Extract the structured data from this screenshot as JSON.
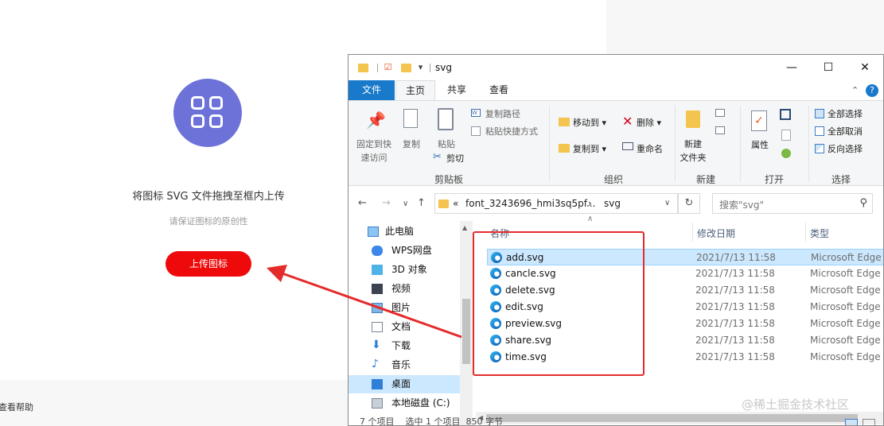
{
  "upload": {
    "title": "将图标 SVG 文件拖拽至框内上传",
    "subtitle": "请保证图标的原创性",
    "button": "上传图标",
    "help": "查看帮助",
    "accent_color": "#ee0a0a",
    "logo_color": "#6d72d8"
  },
  "window": {
    "title": "svg",
    "controls": {
      "minimize": "—",
      "maximize": "☐",
      "close": "✕"
    }
  },
  "ribbon": {
    "tabs": [
      "文件",
      "主页",
      "共享",
      "查看"
    ],
    "clipboard": {
      "pin_line1": "固定到快",
      "pin_line2": "速访问",
      "copy": "复制",
      "paste": "粘贴",
      "copy_path": "复制路径",
      "paste_shortcut": "粘贴快捷方式",
      "cut": "剪切",
      "group": "剪贴板"
    },
    "organize": {
      "move_to": "移动到",
      "copy_to": "复制到",
      "delete": "删除",
      "rename": "重命名",
      "group": "组织"
    },
    "new": {
      "new_folder_line1": "新建",
      "new_folder_line2": "文件夹",
      "group": "新建"
    },
    "open": {
      "properties": "属性",
      "group": "打开"
    },
    "select": {
      "select_all": "全部选择",
      "select_none": "全部取消",
      "invert": "反向选择",
      "group": "选择"
    }
  },
  "address": {
    "prefix": "«",
    "segment1": "font_3243696_hmi3sq5pf...",
    "separator": "›",
    "segment2": "svg",
    "search_placeholder": "搜索\"svg\""
  },
  "nav": {
    "items": [
      "此电脑",
      "WPS网盘",
      "3D 对象",
      "视频",
      "图片",
      "文档",
      "下载",
      "音乐",
      "桌面",
      "本地磁盘 (C:)"
    ],
    "selected_index": 8
  },
  "files": {
    "columns": {
      "name": "名称",
      "date": "修改日期",
      "type": "类型"
    },
    "rows": [
      {
        "name": "add.svg",
        "date": "2021/7/13 11:58",
        "type": "Microsoft Edge"
      },
      {
        "name": "cancle.svg",
        "date": "2021/7/13 11:58",
        "type": "Microsoft Edge"
      },
      {
        "name": "delete.svg",
        "date": "2021/7/13 11:58",
        "type": "Microsoft Edge"
      },
      {
        "name": "edit.svg",
        "date": "2021/7/13 11:58",
        "type": "Microsoft Edge"
      },
      {
        "name": "preview.svg",
        "date": "2021/7/13 11:58",
        "type": "Microsoft Edge"
      },
      {
        "name": "share.svg",
        "date": "2021/7/13 11:58",
        "type": "Microsoft Edge"
      },
      {
        "name": "time.svg",
        "date": "2021/7/13 11:58",
        "type": "Microsoft Edge"
      }
    ],
    "selected_index": 0
  },
  "status": {
    "text": "7 个项目    选中 1 个项目  850 字节"
  },
  "watermark": "@稀土掘金技术社区",
  "annotation_color": "#e52a2a"
}
